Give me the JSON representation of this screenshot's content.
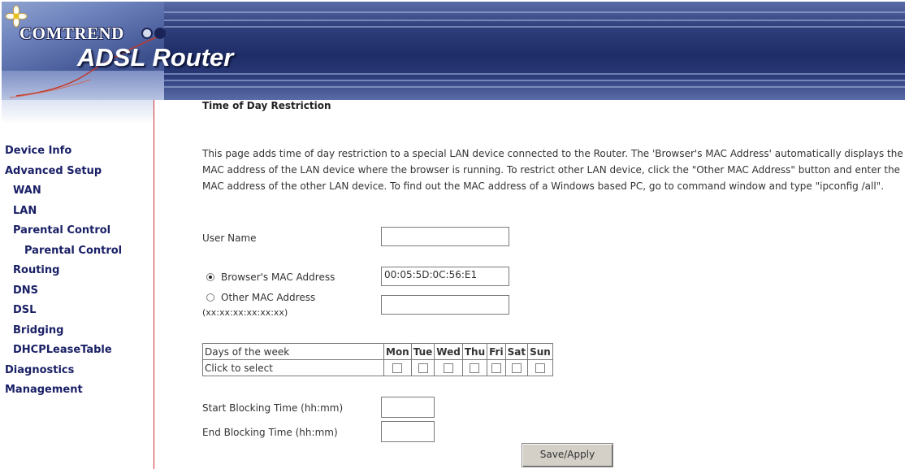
{
  "header": {
    "brand": "COMTREND",
    "product": "ADSL Router"
  },
  "sidebar": {
    "items": [
      {
        "label": "Device Info"
      },
      {
        "label": "Advanced Setup"
      },
      {
        "label": "WAN"
      },
      {
        "label": "LAN"
      },
      {
        "label": "Parental Control"
      },
      {
        "label": "Parental Control"
      },
      {
        "label": "Routing"
      },
      {
        "label": "DNS"
      },
      {
        "label": "DSL"
      },
      {
        "label": "Bridging"
      },
      {
        "label": "DHCPLeaseTable"
      },
      {
        "label": "Diagnostics"
      },
      {
        "label": "Management"
      }
    ]
  },
  "main": {
    "title": "Time of Day Restriction",
    "description": "This page adds time of day restriction to a special LAN device connected to the Router. The 'Browser's MAC Address' automatically displays the MAC address of the LAN device where the browser is running. To restrict other LAN device, click the \"Other MAC Address\" button and enter the MAC address of the other LAN device. To find out the MAC address of a Windows based PC, go to command window and type \"ipconfig /all\".",
    "user_name_label": "User Name",
    "user_name_value": "",
    "browser_mac_label": "Browser's MAC Address",
    "browser_mac_value": "00:05:5D:0C:56:E1",
    "browser_mac_selected": true,
    "other_mac_label": "Other MAC Address",
    "other_mac_hint": "(xx:xx:xx:xx:xx:xx)",
    "other_mac_value": "",
    "days_header_label": "Days of the week",
    "days_select_label": "Click to select",
    "days": [
      "Mon",
      "Tue",
      "Wed",
      "Thu",
      "Fri",
      "Sat",
      "Sun"
    ],
    "start_label": "Start Blocking Time (hh:mm)",
    "start_value": "",
    "end_label": "End Blocking Time (hh:mm)",
    "end_value": "",
    "save_button": "Save/Apply"
  },
  "colors": {
    "nav_text": "#1a2066",
    "banner": "#1e2c66",
    "sidebar_border": "#cc3333"
  }
}
